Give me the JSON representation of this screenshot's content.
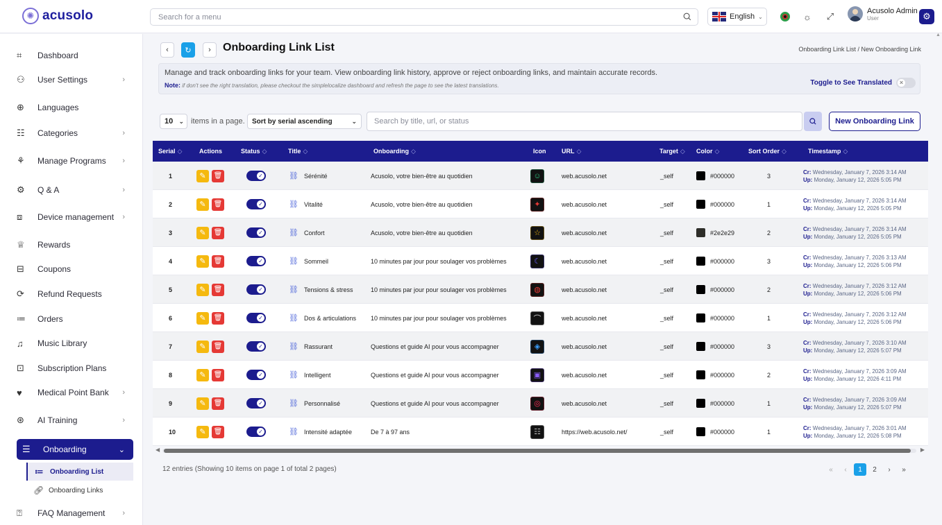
{
  "brand": {
    "name": "acusolo"
  },
  "topbar": {
    "search_placeholder": "Search for a menu",
    "language": "English",
    "user_name": "Acusolo Admin",
    "user_role": "User"
  },
  "sidebar": {
    "items": [
      {
        "label": "Dashboard",
        "icon": "grid-icon",
        "chev": ""
      },
      {
        "label": "User Settings",
        "icon": "users-icon",
        "chev": "›"
      },
      {
        "label": "Languages",
        "icon": "globe-icon",
        "chev": ""
      },
      {
        "label": "Categories",
        "icon": "list-icon",
        "chev": "›"
      },
      {
        "label": "Manage Programs",
        "icon": "hub-icon",
        "chev": "›"
      },
      {
        "label": "Q & A",
        "icon": "qa-icon",
        "chev": "›"
      },
      {
        "label": "Device management",
        "icon": "device-icon",
        "chev": "›"
      },
      {
        "label": "Rewards",
        "icon": "trophy-icon",
        "chev": ""
      },
      {
        "label": "Coupons",
        "icon": "ticket-icon",
        "chev": ""
      },
      {
        "label": "Refund Requests",
        "icon": "refund-icon",
        "chev": ""
      },
      {
        "label": "Orders",
        "icon": "orders-icon",
        "chev": ""
      },
      {
        "label": "Music Library",
        "icon": "music-icon",
        "chev": ""
      },
      {
        "label": "Subscription Plans",
        "icon": "card-icon",
        "chev": ""
      },
      {
        "label": "Medical Point Bank",
        "icon": "heart-icon",
        "chev": "›"
      },
      {
        "label": "AI Training",
        "icon": "ai-icon",
        "chev": "›"
      }
    ],
    "active": {
      "label": "Onboarding",
      "chev": "⌄"
    },
    "sub_items": [
      {
        "label": "Onboarding List"
      },
      {
        "label": "Onboarding Links"
      }
    ],
    "faq": {
      "label": "FAQ Management",
      "chev": "›"
    }
  },
  "page": {
    "title": "Onboarding Link List",
    "breadcrumb": "Onboarding Link List / New Onboarding Link",
    "description": "Manage and track onboarding links for your team. View onboarding link history, approve or reject onboarding links, and maintain accurate records.",
    "note_label": "Note:",
    "note_text": " if don't see the right translation, please checkout the simplelocalize dashboard and refresh the page to see the latest translations.",
    "toggle_label": "Toggle to See Translated"
  },
  "controls": {
    "per_page": "10",
    "per_page_label": "items in a page.",
    "sort": "Sort by serial ascending",
    "search_placeholder": "Search by title, url, or status",
    "new_button": "New Onboarding Link"
  },
  "table": {
    "columns": [
      "Serial",
      "Actions",
      "Status",
      "Title",
      "Onboarding",
      "Icon",
      "URL",
      "Target",
      "Color",
      "Sort Order",
      "Timestamp"
    ],
    "created_prefix": "Cr:",
    "updated_prefix": "Up:",
    "rows": [
      {
        "serial": "1",
        "title": "Sérénité",
        "onboarding": "Acusolo, votre bien-être au quotidien",
        "icon_glyph": "☺",
        "icon_color": "#2ec27e",
        "url": "web.acusolo.net",
        "target": "_self",
        "color": "#000000",
        "sort": "3",
        "cr": "Wednesday, January 7, 2026 3:14 AM",
        "up": "Monday, January 12, 2026 5:05 PM"
      },
      {
        "serial": "2",
        "title": "Vitalité",
        "onboarding": "Acusolo, votre bien-être au quotidien",
        "icon_glyph": "✦",
        "icon_color": "#e53935",
        "url": "web.acusolo.net",
        "target": "_self",
        "color": "#000000",
        "sort": "1",
        "cr": "Wednesday, January 7, 2026 3:14 AM",
        "up": "Monday, January 12, 2026 5:05 PM"
      },
      {
        "serial": "3",
        "title": "Confort",
        "onboarding": "Acusolo, votre bien-être au quotidien",
        "icon_glyph": "☆",
        "icon_color": "#f5b90f",
        "url": "web.acusolo.net",
        "target": "_self",
        "color": "#2e2e29",
        "sort": "2",
        "cr": "Wednesday, January 7, 2026 3:14 AM",
        "up": "Monday, January 12, 2026 5:05 PM"
      },
      {
        "serial": "4",
        "title": "Sommeil",
        "onboarding": "10 minutes par jour pour soulager vos problèmes",
        "icon_glyph": "☾",
        "icon_color": "#6a5cff",
        "url": "web.acusolo.net",
        "target": "_self",
        "color": "#000000",
        "sort": "3",
        "cr": "Wednesday, January 7, 2026 3:13 AM",
        "up": "Monday, January 12, 2026 5:06 PM"
      },
      {
        "serial": "5",
        "title": "Tensions & stress",
        "onboarding": "10 minutes par jour pour soulager vos problèmes",
        "icon_glyph": "◍",
        "icon_color": "#e53935",
        "url": "web.acusolo.net",
        "target": "_self",
        "color": "#000000",
        "sort": "2",
        "cr": "Wednesday, January 7, 2026 3:12 AM",
        "up": "Monday, January 12, 2026 5:06 PM"
      },
      {
        "serial": "6",
        "title": "Dos & articulations",
        "onboarding": "10 minutes par jour pour soulager vos problèmes",
        "icon_glyph": "⌒",
        "icon_color": "#dddddd",
        "url": "web.acusolo.net",
        "target": "_self",
        "color": "#000000",
        "sort": "1",
        "cr": "Wednesday, January 7, 2026 3:12 AM",
        "up": "Monday, January 12, 2026 5:06 PM"
      },
      {
        "serial": "7",
        "title": "Rassurant",
        "onboarding": "Questions et guide AI pour vous accompagner",
        "icon_glyph": "◈",
        "icon_color": "#3aa0ff",
        "url": "web.acusolo.net",
        "target": "_self",
        "color": "#000000",
        "sort": "3",
        "cr": "Wednesday, January 7, 2026 3:10 AM",
        "up": "Monday, January 12, 2026 5:07 PM"
      },
      {
        "serial": "8",
        "title": "Intelligent",
        "onboarding": "Questions et guide AI pour vous accompagner",
        "icon_glyph": "▣",
        "icon_color": "#8a5cff",
        "url": "web.acusolo.net",
        "target": "_self",
        "color": "#000000",
        "sort": "2",
        "cr": "Wednesday, January 7, 2026 3:09 AM",
        "up": "Monday, January 12, 2026 4:11 PM"
      },
      {
        "serial": "9",
        "title": "Personnalisé",
        "onboarding": "Questions et guide AI pour vous accompagner",
        "icon_glyph": "◎",
        "icon_color": "#ff2d55",
        "url": "web.acusolo.net",
        "target": "_self",
        "color": "#000000",
        "sort": "1",
        "cr": "Wednesday, January 7, 2026 3:09 AM",
        "up": "Monday, January 12, 2026 5:07 PM"
      },
      {
        "serial": "10",
        "title": "Intensité adaptée",
        "onboarding": "De 7 à 97 ans",
        "icon_glyph": "☷",
        "icon_color": "#bbbbbb",
        "url": "https://web.acusolo.net/",
        "target": "_self",
        "color": "#000000",
        "sort": "1",
        "cr": "Wednesday, January 7, 2026 3:01 AM",
        "up": "Monday, January 12, 2026 5:08 PM"
      }
    ]
  },
  "footer": {
    "entries": "12 entries (Showing 10 items on page 1 of total 2 pages)",
    "pages": [
      "1",
      "2"
    ],
    "current_page": "1"
  },
  "colors": {
    "primary": "#1c1c8e",
    "accent": "#1aa0e8",
    "edit": "#f5b90f",
    "delete": "#e53935"
  }
}
